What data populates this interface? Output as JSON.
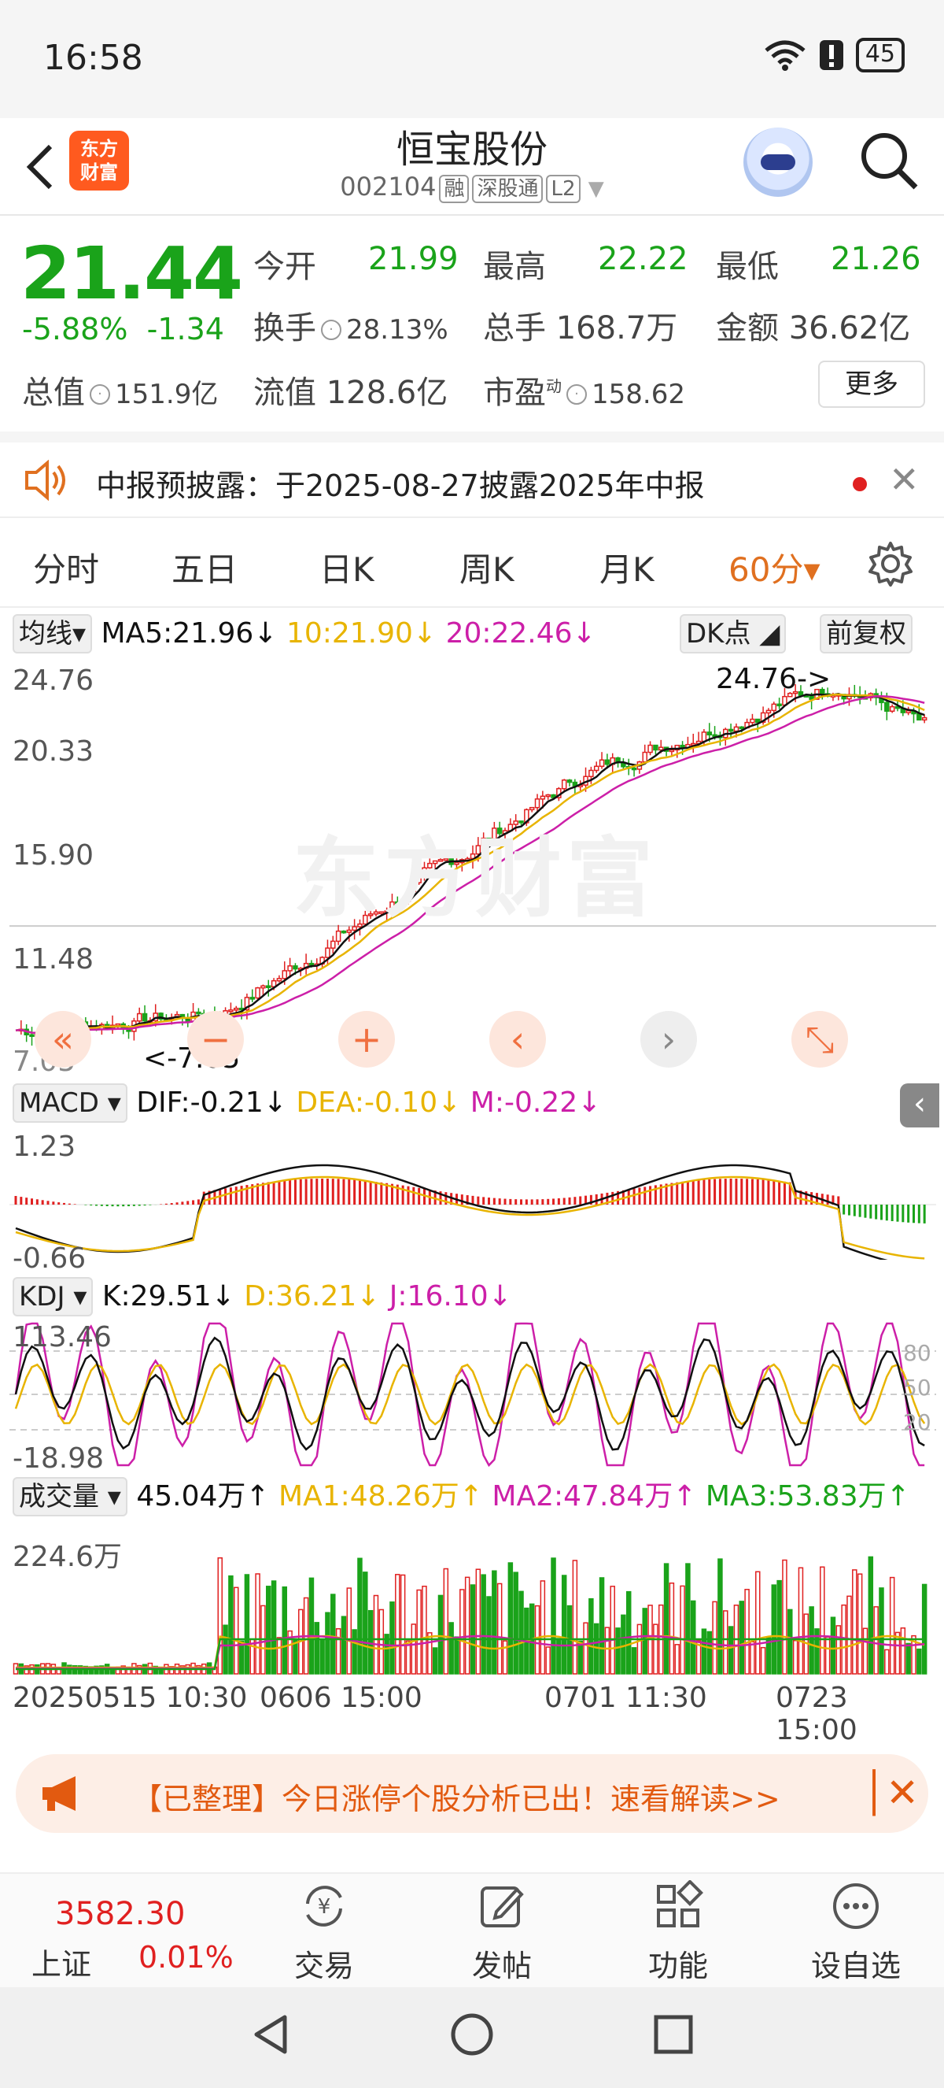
{
  "status_bar": {
    "time": "16:58",
    "battery": "45"
  },
  "header": {
    "logo_text": "东方\n财富",
    "stock_name": "恒宝股份",
    "stock_code": "002104",
    "tags": [
      "融",
      "深股通",
      "L2"
    ]
  },
  "quote": {
    "price": "21.44",
    "change_pct": "-5.88%",
    "change_abs": "-1.34",
    "open_label": "今开",
    "open": "21.99",
    "high_label": "最高",
    "high": "22.22",
    "low_label": "最低",
    "low": "21.26",
    "turnover_label": "换手",
    "turnover": "28.13%",
    "volume_label": "总手",
    "volume": "168.7万",
    "amount_label": "金额",
    "amount": "36.62亿",
    "mktcap_label": "总值",
    "mktcap": "151.9亿",
    "float_label": "流值",
    "float_cap": "128.6亿",
    "pe_label": "市盈",
    "pe_sup": "动",
    "pe": "158.62",
    "more_label": "更多"
  },
  "notice": {
    "text": "中报预披露：于2025-08-27披露2025年中报"
  },
  "period_tabs": {
    "items": [
      "分时",
      "五日",
      "日K",
      "周K",
      "月K",
      "60分▾"
    ],
    "active": "60分▾"
  },
  "kline": {
    "indicator": "均线",
    "ma5": "MA5:21.96↓",
    "ma10": "10:21.90↓",
    "ma20": "20:22.46↓",
    "dk_label": "DK点",
    "adjust_label": "前复权",
    "y_ticks": [
      "24.76",
      "20.33",
      "15.90",
      "11.48",
      "7.05"
    ],
    "max_marker": "24.76->",
    "min_marker": "<-7.05",
    "watermark": "东方财富"
  },
  "macd": {
    "indicator": "MACD",
    "dif": "DIF:-0.21↓",
    "dea": "DEA:-0.10↓",
    "m": "M:-0.22↓",
    "y_ticks": [
      "1.23",
      "-0.66"
    ]
  },
  "kdj": {
    "indicator": "KDJ",
    "k": "K:29.51↓",
    "d": "D:36.21↓",
    "j": "J:16.10↓",
    "y_ticks": [
      "113.46",
      "-18.98"
    ],
    "ref_ticks": [
      "80",
      "50",
      "20"
    ]
  },
  "volume": {
    "indicator": "成交量",
    "vol": "45.04万↑",
    "ma1": "MA1:48.26万↑",
    "ma2": "MA2:47.84万↑",
    "ma3": "MA3:53.83万↑",
    "y_tick": "224.6万",
    "x_ticks": [
      "20250515 10:30",
      "0606 15:00",
      "0701 11:30",
      "0723 15:00"
    ]
  },
  "colors": {
    "up": "#e02020",
    "down": "#1aa31a",
    "accent": "#e07020",
    "ma5": "#111111",
    "ma10": "#e8b400",
    "ma20": "#cc1fa8"
  },
  "banner": {
    "text": "【已整理】今日涨停个股分析已出！速看解读>>"
  },
  "bottom_nav": {
    "index_value": "3582.30",
    "index_name": "上证",
    "index_pct": "0.01%",
    "items": [
      "交易",
      "发帖",
      "功能",
      "设自选"
    ]
  }
}
